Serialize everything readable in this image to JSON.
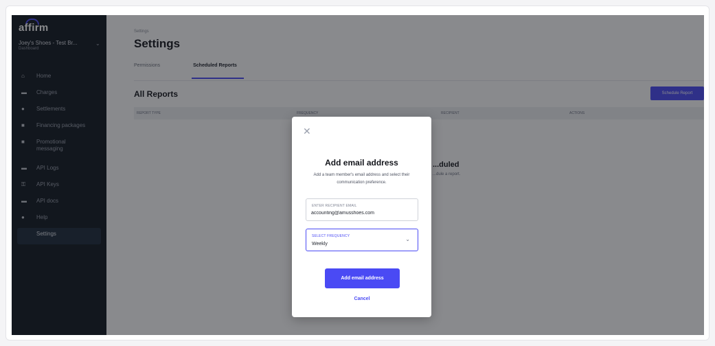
{
  "sidebar": {
    "logo": "affirm",
    "merchant_name": "Joey's Shoes - Test Br...",
    "merchant_sub": "Dashboard",
    "items": [
      {
        "label": "Home",
        "icon": "home-icon",
        "glyph": "⌂"
      },
      {
        "label": "Charges",
        "icon": "charges-icon",
        "glyph": "▬"
      },
      {
        "label": "Settlements",
        "icon": "settlements-icon",
        "glyph": "●"
      },
      {
        "label": "Financing packages",
        "icon": "package-icon",
        "glyph": "■"
      },
      {
        "label": "Promotional messaging",
        "icon": "megaphone-icon",
        "glyph": "■"
      },
      {
        "label": "API Logs",
        "icon": "logs-icon",
        "glyph": "▬"
      },
      {
        "label": "API Keys",
        "icon": "key-icon",
        "glyph": "⚿"
      },
      {
        "label": "API docs",
        "icon": "docs-icon",
        "glyph": "▬"
      },
      {
        "label": "Help",
        "icon": "help-icon",
        "glyph": "●"
      },
      {
        "label": "Settings",
        "icon": "settings-icon",
        "glyph": ""
      }
    ]
  },
  "header": {
    "breadcrumb": "Settings",
    "title": "Settings",
    "tabs": [
      {
        "label": "Permissions"
      },
      {
        "label": "Scheduled Reports"
      }
    ]
  },
  "reports": {
    "heading": "All Reports",
    "schedule_button": "Schedule Report",
    "columns": [
      "REPORT TYPE",
      "FREQUENCY",
      "RECIPIENT",
      "ACTIONS"
    ],
    "empty_title": "...duled",
    "empty_sub": "...dule a report."
  },
  "modal": {
    "title": "Add email address",
    "description": "Add a team member's email address and select their communication preference.",
    "email_label": "ENTER RECIPIENT EMAIL",
    "email_value": "accounting@amusshoes.com",
    "frequency_label": "SELECT FREQUENCY",
    "frequency_value": "Weekly",
    "submit_label": "Add email address",
    "cancel_label": "Cancel"
  },
  "colors": {
    "accent": "#4a4af4",
    "sidebar_bg": "#101820",
    "overlay": "rgba(20,22,28,0.5)"
  }
}
